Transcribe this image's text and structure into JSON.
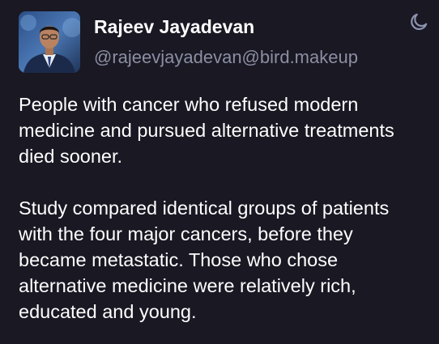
{
  "post": {
    "author": {
      "display_name": "Rajeev Jayadevan",
      "handle": "@rajeevjayadevan@bird.makeup"
    },
    "theme_toggle_icon": "moon-icon",
    "paragraphs": [
      "People with cancer who refused modern\nmedicine and pursued alternative treatments\ndied sooner.",
      "Study compared identical groups of patients\nwith the four major cancers, before they\nbecame metastatic. Those who chose\nalternative medicine were relatively rich,\neducated and young."
    ]
  },
  "colors": {
    "background": "#191823",
    "text": "#ffffff",
    "handle": "#8b8fa3",
    "icon": "#8e94b0"
  }
}
